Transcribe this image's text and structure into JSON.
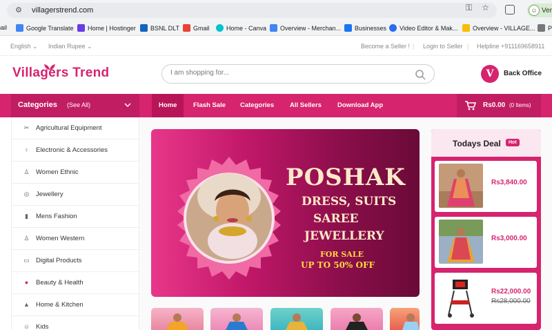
{
  "browser": {
    "url": "villagerstrend.com",
    "profile_label": "Ver",
    "bookmarks": [
      {
        "label": "nail",
        "color": "#ea4335"
      },
      {
        "label": "Google Translate",
        "color": "#4285f4"
      },
      {
        "label": "Home | Hostinger",
        "color": "#673de6"
      },
      {
        "label": "BSNL DLT",
        "color": "#1565c0"
      },
      {
        "label": "Gmail",
        "color": "#ea4335"
      },
      {
        "label": "Home - Canva",
        "color": "#00c4cc"
      },
      {
        "label": "Overview - Merchan...",
        "color": "#4285f4"
      },
      {
        "label": "Businesses",
        "color": "#1877f2"
      },
      {
        "label": "Video Editor & Mak...",
        "color": "#2b6cf0"
      },
      {
        "label": "Overview - VILLAGE...",
        "color": "#fbbc04"
      },
      {
        "label": "P",
        "color": "#555"
      }
    ]
  },
  "utility": {
    "language": "English",
    "currency": "Indian Rupee",
    "become_seller": "Become a Seller !",
    "login_seller": "Login to Seller",
    "helpline": "Helpline +911169658911"
  },
  "header": {
    "logo": "Villagers Trend",
    "search_placeholder": "I am shopping for...",
    "back_office": "Back Office",
    "back_office_logo_letter": "V"
  },
  "nav": {
    "categories_title": "Categories",
    "see_all": "(See All)",
    "items": [
      "Home",
      "Flash Sale",
      "Categories",
      "All Sellers",
      "Download App"
    ],
    "cart_amount": "Rs0.00",
    "cart_items": "(0 Items)"
  },
  "sidebar": {
    "items": [
      {
        "label": "Agricultural Equipment",
        "icon": "tools-icon"
      },
      {
        "label": "Electronic & Accessories",
        "icon": "bulb-icon"
      },
      {
        "label": "Women Ethnic",
        "icon": "dress-icon"
      },
      {
        "label": "Jewellery",
        "icon": "ring-icon"
      },
      {
        "label": "Mens Fashion",
        "icon": "shirt-icon"
      },
      {
        "label": "Women Western",
        "icon": "dress-icon"
      },
      {
        "label": "Digital Products",
        "icon": "monitor-icon"
      },
      {
        "label": "Beauty & Health",
        "icon": "beauty-icon"
      },
      {
        "label": "Home & Kitchen",
        "icon": "home-icon"
      },
      {
        "label": "Kids",
        "icon": "kids-icon"
      }
    ]
  },
  "banner": {
    "title": "POSHAK",
    "line1": "DRESS, SUITS",
    "line2": "SAREE",
    "line3": "JEWELLERY",
    "sale": "FOR SALE",
    "offer": "UP TO 50% OFF"
  },
  "deal": {
    "title": "Todays Deal",
    "badge": "Hot",
    "products": [
      {
        "price": "Rs3,840.00",
        "old_price": ""
      },
      {
        "price": "Rs3,000.00",
        "old_price": ""
      },
      {
        "price": "Rs22,000.00",
        "old_price": "Rs28,000.00"
      }
    ]
  },
  "colors": {
    "brand": "#d6246e",
    "brand_dark": "#c11d62",
    "banner_text": "#fde9c8",
    "offer_text": "#ffd93b"
  }
}
